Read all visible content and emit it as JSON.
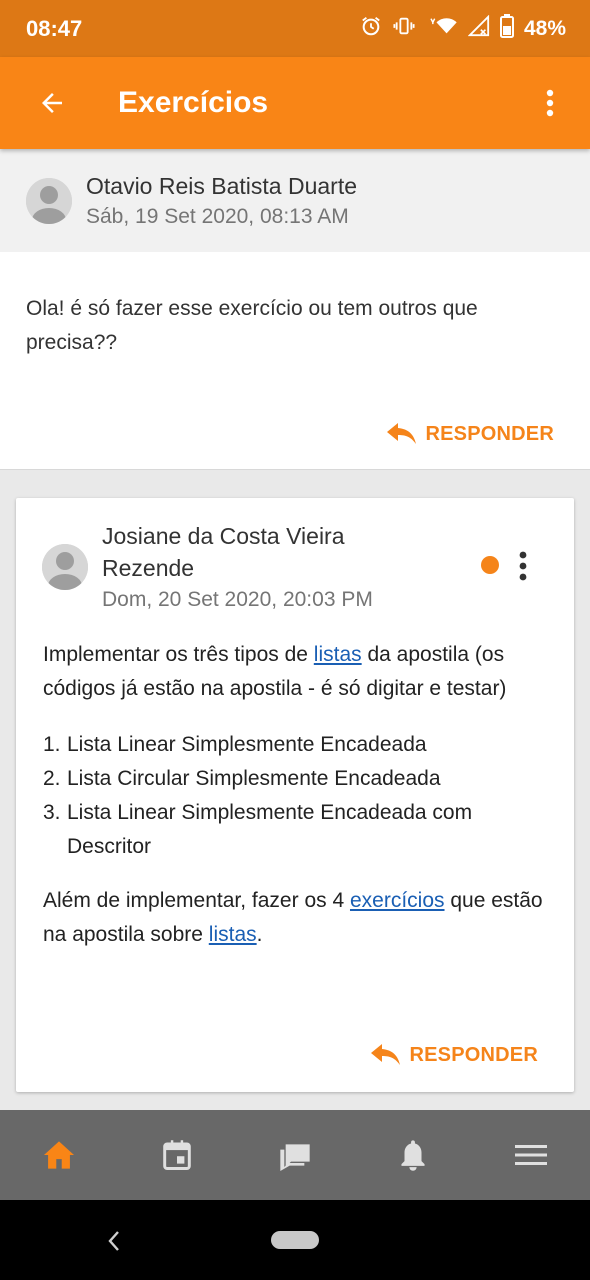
{
  "status_bar": {
    "time": "08:47",
    "battery": "48%",
    "icons": [
      "alarm-icon",
      "vibrate-icon",
      "wifi-icon",
      "signal-icon",
      "battery-icon"
    ]
  },
  "app_bar": {
    "title": "Exercícios",
    "back_icon": "arrow-back-icon",
    "menu_icon": "more-vert-icon"
  },
  "first_post": {
    "author": "Otavio Reis Batista Duarte",
    "date": "Sáb, 19 Set 2020, 08:13 AM",
    "message": "Ola! é só fazer esse exercício ou tem outros que precisa??",
    "reply_label": "RESPONDER"
  },
  "reply_post": {
    "author_line1": "Josiane da Costa Vieira",
    "author_line2": "Rezende",
    "date": "Dom, 20 Set 2020, 20:03 PM",
    "intro_before_link": "Implementar os três tipos de ",
    "intro_link": "listas",
    "intro_after_link": " da apostila (os códigos já estão na apostila - é só digitar e testar)",
    "list": [
      {
        "num": "1.",
        "text": "Lista Linear Simplesmente Encadeada"
      },
      {
        "num": "2.",
        "text": "Lista Circular Simplesmente Encadeada"
      },
      {
        "num": "3.",
        "text": "Lista Linear Simplesmente Encadeada com Descritor"
      }
    ],
    "outro_before_link": "Além de implementar, fazer os 4 ",
    "outro_link1": "exercícios",
    "outro_middle": " que estão na apostila sobre ",
    "outro_link2": "listas",
    "outro_end": ".",
    "reply_label": "RESPONDER"
  },
  "bottom_nav": {
    "items": [
      "home-icon",
      "calendar-icon",
      "forum-icon",
      "notifications-icon",
      "menu-icon"
    ],
    "active": "home-icon"
  },
  "colors": {
    "accent": "#f98516",
    "status_bar": "#dd7815",
    "link": "#1a5fb4",
    "bottom_nav": "#686868"
  }
}
